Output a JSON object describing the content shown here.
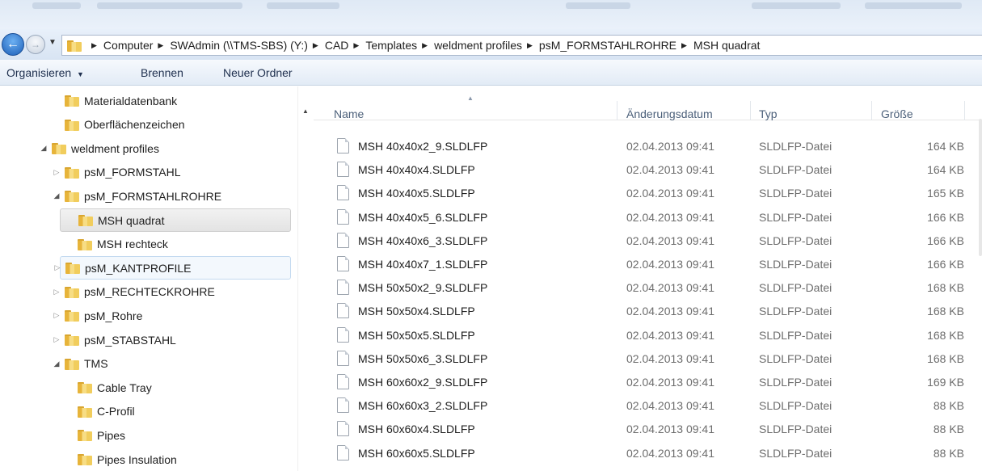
{
  "breadcrumb": [
    "Computer",
    "SWAdmin (\\\\TMS-SBS) (Y:)",
    "CAD",
    "Templates",
    "weldment profiles",
    "psM_FORMSTAHLROHRE",
    "MSH quadrat"
  ],
  "toolbar": {
    "organize": "Organisieren",
    "organize_arrow": "▼",
    "burn": "Brennen",
    "new_folder": "Neuer Ordner"
  },
  "tree": [
    {
      "label": "Materialdatenbank",
      "expander": ""
    },
    {
      "label": "Oberflächenzeichen",
      "expander": ""
    },
    {
      "label": "weldment profiles",
      "expander": "◢"
    },
    {
      "label": "psM_FORMSTAHL",
      "expander": "▷"
    },
    {
      "label": "psM_FORMSTAHLROHRE",
      "expander": "◢"
    },
    {
      "label": "MSH quadrat",
      "expander": ""
    },
    {
      "label": "MSH rechteck",
      "expander": ""
    },
    {
      "label": "psM_KANTPROFILE",
      "expander": "▷"
    },
    {
      "label": "psM_RECHTECKROHRE",
      "expander": "▷"
    },
    {
      "label": "psM_Rohre",
      "expander": "▷"
    },
    {
      "label": "psM_STABSTAHL",
      "expander": "▷"
    },
    {
      "label": "TMS",
      "expander": "◢"
    },
    {
      "label": "Cable Tray",
      "expander": ""
    },
    {
      "label": "C-Profil",
      "expander": ""
    },
    {
      "label": "Pipes",
      "expander": ""
    },
    {
      "label": "Pipes Insulation",
      "expander": ""
    }
  ],
  "columns": {
    "name": "Name",
    "date": "Änderungsdatum",
    "type": "Typ",
    "size": "Größe"
  },
  "files": [
    {
      "name": "MSH 40x40x2_9.SLDLFP",
      "date": "02.04.2013 09:41",
      "type": "SLDLFP-Datei",
      "size": "164 KB"
    },
    {
      "name": "MSH 40x40x4.SLDLFP",
      "date": "02.04.2013 09:41",
      "type": "SLDLFP-Datei",
      "size": "164 KB"
    },
    {
      "name": "MSH 40x40x5.SLDLFP",
      "date": "02.04.2013 09:41",
      "type": "SLDLFP-Datei",
      "size": "165 KB"
    },
    {
      "name": "MSH 40x40x5_6.SLDLFP",
      "date": "02.04.2013 09:41",
      "type": "SLDLFP-Datei",
      "size": "166 KB"
    },
    {
      "name": "MSH 40x40x6_3.SLDLFP",
      "date": "02.04.2013 09:41",
      "type": "SLDLFP-Datei",
      "size": "166 KB"
    },
    {
      "name": "MSH 40x40x7_1.SLDLFP",
      "date": "02.04.2013 09:41",
      "type": "SLDLFP-Datei",
      "size": "166 KB"
    },
    {
      "name": "MSH 50x50x2_9.SLDLFP",
      "date": "02.04.2013 09:41",
      "type": "SLDLFP-Datei",
      "size": "168 KB"
    },
    {
      "name": "MSH 50x50x4.SLDLFP",
      "date": "02.04.2013 09:41",
      "type": "SLDLFP-Datei",
      "size": "168 KB"
    },
    {
      "name": "MSH 50x50x5.SLDLFP",
      "date": "02.04.2013 09:41",
      "type": "SLDLFP-Datei",
      "size": "168 KB"
    },
    {
      "name": "MSH 50x50x6_3.SLDLFP",
      "date": "02.04.2013 09:41",
      "type": "SLDLFP-Datei",
      "size": "168 KB"
    },
    {
      "name": "MSH 60x60x2_9.SLDLFP",
      "date": "02.04.2013 09:41",
      "type": "SLDLFP-Datei",
      "size": "169 KB"
    },
    {
      "name": "MSH 60x60x3_2.SLDLFP",
      "date": "02.04.2013 09:41",
      "type": "SLDLFP-Datei",
      "size": "88 KB"
    },
    {
      "name": "MSH 60x60x4.SLDLFP",
      "date": "02.04.2013 09:41",
      "type": "SLDLFP-Datei",
      "size": "88 KB"
    },
    {
      "name": "MSH 60x60x5.SLDLFP",
      "date": "02.04.2013 09:41",
      "type": "SLDLFP-Datei",
      "size": "88 KB"
    }
  ]
}
